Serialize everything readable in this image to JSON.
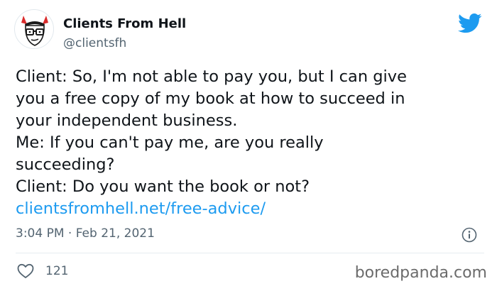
{
  "tweet": {
    "display_name": "Clients From Hell",
    "handle": "@clientsfh",
    "lines": [
      "Client: So, I'm not able to pay you, but I can give",
      "you a free copy of my book at how to succeed in",
      "your independent business.",
      "Me: If you can't pay me, are you really",
      "succeeding?",
      "Client: Do you want the book or not?"
    ],
    "link": "clientsfromhell.net/free-advice/",
    "timestamp": "3:04 PM · Feb 21, 2021",
    "likes": "121"
  },
  "watermark": "boredpanda.com",
  "icons": {
    "brand": "twitter-bird-icon",
    "info": "info-icon",
    "like": "heart-icon"
  },
  "colors": {
    "twitter_blue": "#1d9bf0",
    "text": "#0f1419",
    "secondary": "#536471"
  }
}
